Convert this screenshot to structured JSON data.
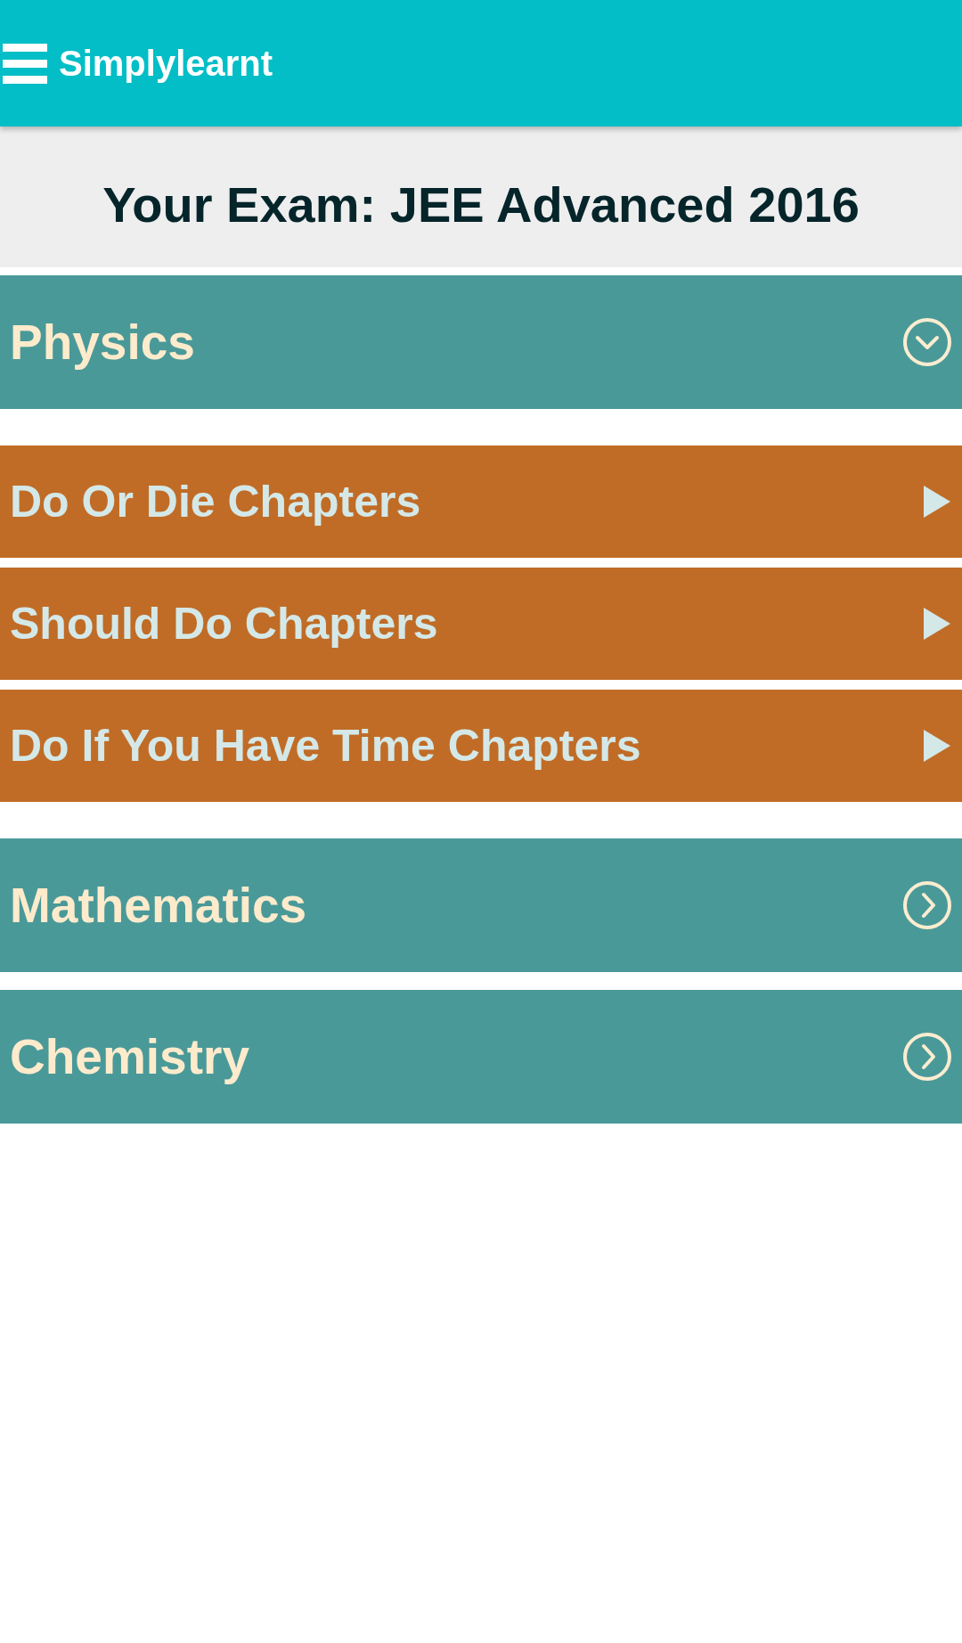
{
  "app_bar": {
    "title": "Simplylearnt"
  },
  "exam_banner": {
    "text": "Your Exam: JEE Advanced 2016"
  },
  "subjects": [
    {
      "name": "Physics",
      "expanded": true,
      "children": [
        {
          "label": "Do Or Die Chapters"
        },
        {
          "label": "Should Do Chapters"
        },
        {
          "label": "Do If You Have Time Chapters"
        }
      ]
    },
    {
      "name": "Mathematics",
      "expanded": false
    },
    {
      "name": "Chemistry",
      "expanded": false
    }
  ]
}
